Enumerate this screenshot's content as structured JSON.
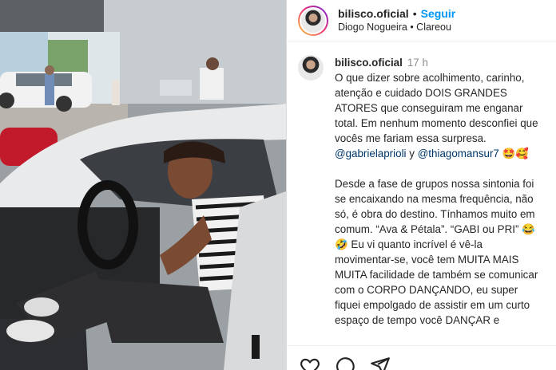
{
  "post": {
    "username": "bilisco.oficial",
    "follow_label": "Seguir",
    "subtitle": "Diogo Nogueira • Clareou"
  },
  "caption": {
    "username": "bilisco.oficial",
    "time": "17 h",
    "p1_text": "O que dizer sobre acolhimento, carinho, atenção e cuidado DOIS GRANDES ATORES que conseguiram me enganar total. Em nenhum momento desconfiei que vocês me fariam essa surpresa.",
    "mention1": "@gabrielaprioli",
    "conj": "y",
    "mention2": "@thiagomansur7",
    "emoji1": "🤩🥰",
    "p2_text_a": "Desde a fase de grupos nossa sintonia foi se encaixando na mesma frequência, não só, é obra do destino. Tínhamos muito em comum. “Ava & Pétala”. “GABI ou PRI”",
    "emoji2": "😂🤣",
    "p2_text_b": "Eu vi quanto incrível é vê-la movimentar-se, você tem MUITA MAIS MUITA facilidade de também se comunicar com o CORPO DANÇANDO, eu super fiquei empolgado de assistir em um curto espaço de tempo você DANÇAR e"
  },
  "icons": {
    "like": "heart-icon",
    "comment": "comment-icon",
    "share": "share-icon"
  }
}
